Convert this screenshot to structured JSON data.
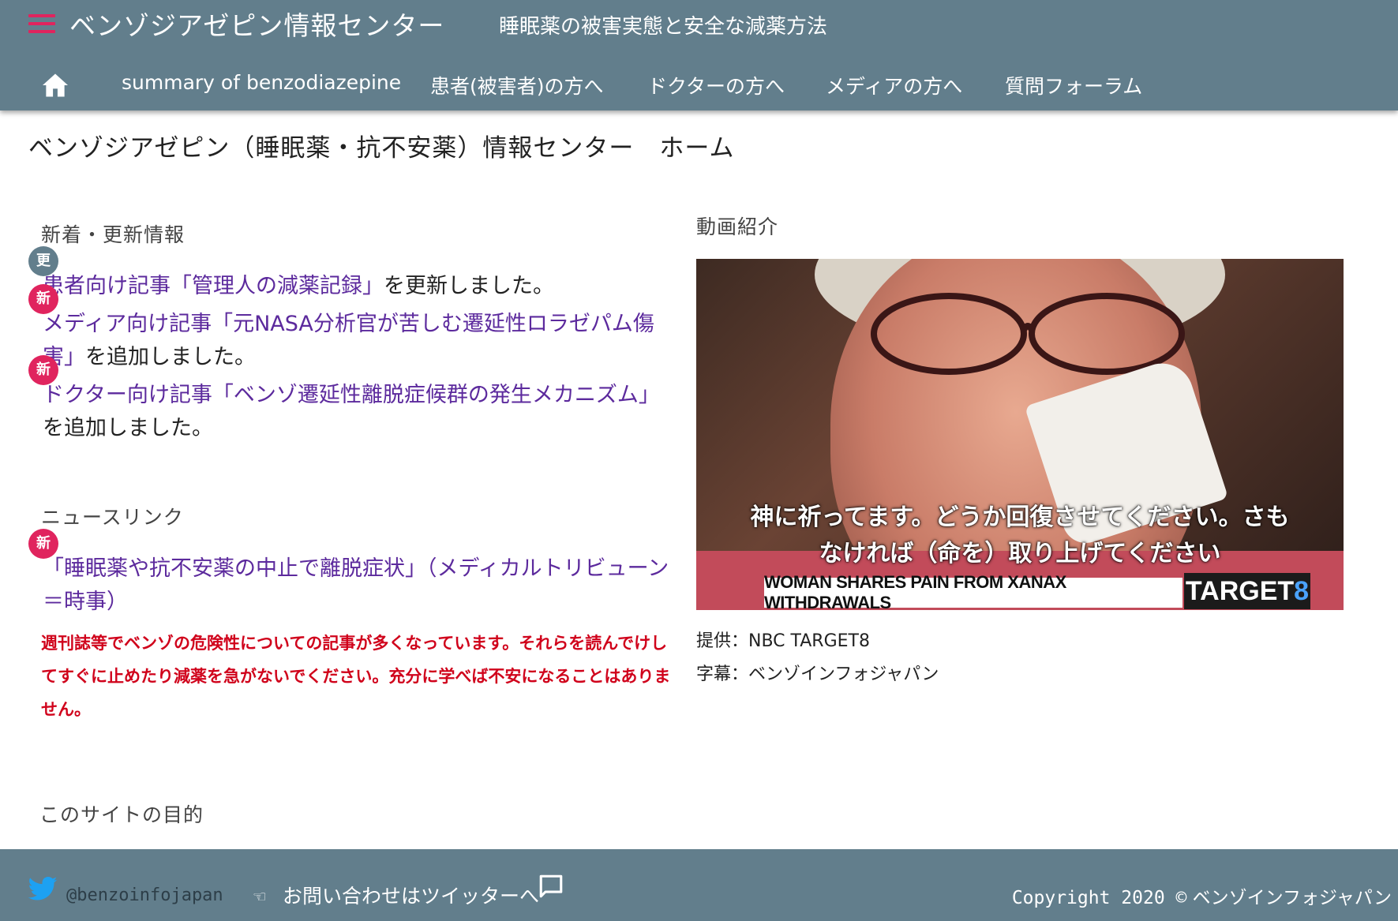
{
  "header": {
    "title": "ベンゾジアゼピン情報センター",
    "subtitle": "睡眠薬の被害実態と安全な減薬方法",
    "menu_icon": "hamburger-menu-icon",
    "accent_color": "#e0245e",
    "bar_color": "#627e8c"
  },
  "nav": {
    "home_icon": "home-icon",
    "items": [
      {
        "label": "summary of benzodiazepine"
      },
      {
        "label": "患者(被害者)の方へ"
      },
      {
        "label": "ドクターの方へ"
      },
      {
        "label": "メディアの方へ"
      },
      {
        "label": "質問フォーラム"
      }
    ]
  },
  "page_title": "ベンゾジアゼピン（睡眠薬・抗不安薬）情報センター　ホーム",
  "updates": {
    "label": "新着・更新情報",
    "items": [
      {
        "badge": "更",
        "link": "患者向け記事「管理人の減薬記録」",
        "rest": "を更新しました。"
      },
      {
        "badge": "新",
        "link": "メディア向け記事「元NASA分析官が苦しむ遷延性ロラゼパム傷害」",
        "rest": "を追加しました。"
      },
      {
        "badge": "新",
        "link": "ドクター向け記事「ベンゾ遷延性離脱症候群の発生メカニズム」",
        "rest": "を追加しました。"
      }
    ]
  },
  "news_links": {
    "label": "ニュースリンク",
    "items": [
      {
        "badge": "新",
        "link": "「睡眠薬や抗不安薬の中止で離脱症状」（メディカルトリビューン＝時事）"
      }
    ],
    "warning": "週刊誌等でベンゾの危険性についての記事が多くなっています。それらを読んでけしてすぐに止めたり減薬を急がないでください。充分に学べば不安になることはありません。"
  },
  "video": {
    "label": "動画紹介",
    "subtitle_line1": "神に祈ってます。どうか回復させてください。さも",
    "subtitle_line2": "なければ（命を）取り上げてください",
    "lower_third": "WOMAN SHARES PAIN FROM XANAX WITHDRAWALS",
    "brand": "TARGET",
    "brand_num": "8",
    "credit_provided": "提供：NBC TARGET8",
    "credit_subtitles": "字幕：ベンゾインフォジャパン"
  },
  "purpose": {
    "label": "このサイトの目的"
  },
  "footer": {
    "twitter_icon": "twitter-bird-icon",
    "handle": "@benzoinfojapan",
    "hand_icon": "☜",
    "contact": "お問い合わせはツイッターへ",
    "chat_icon": "chat-bubble-icon",
    "copyright_mono": "Copyright 2020 ©",
    "copyright_name": " ベンゾインフォジャパン"
  }
}
